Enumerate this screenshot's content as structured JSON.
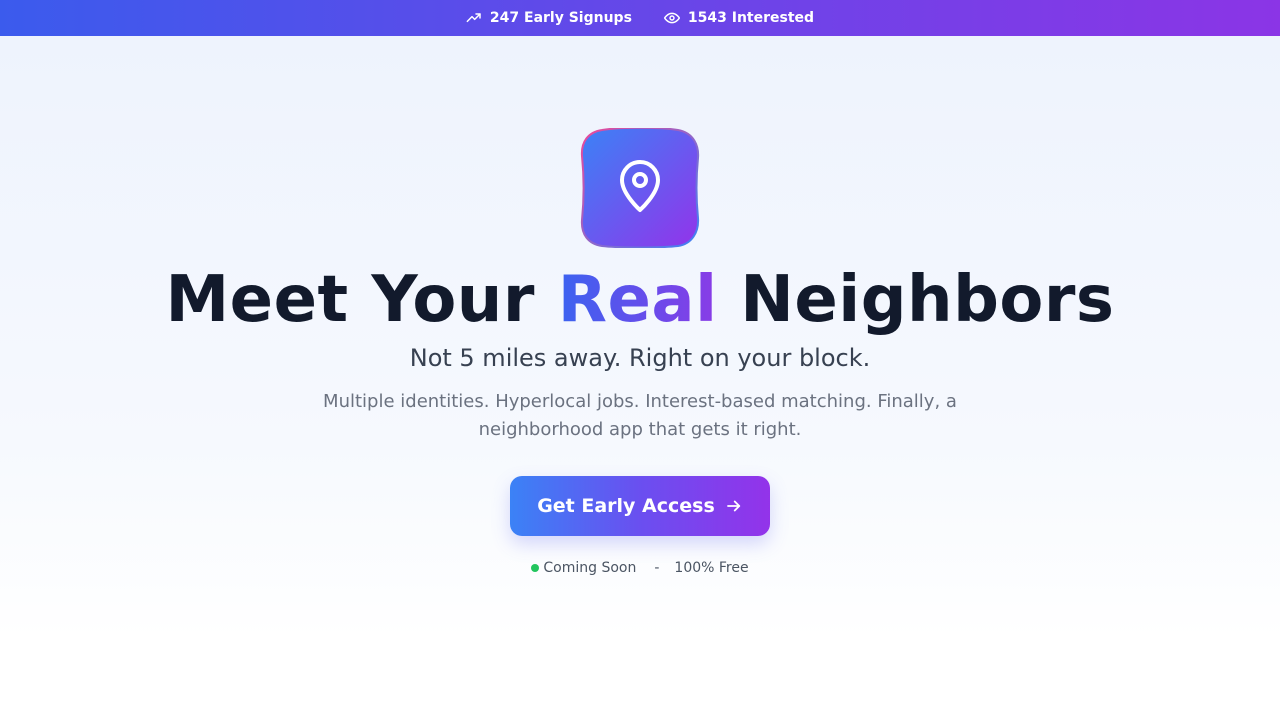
{
  "topbar": {
    "signups": "247 Early Signups",
    "interested": "1543 Interested",
    "signups_icon": "trending-up-icon",
    "interested_icon": "eye-icon"
  },
  "hero": {
    "logo_icon": "map-pin-icon",
    "headline_before": "Meet Your ",
    "headline_accent": "Real",
    "headline_after": " Neighbors",
    "subhead": "Not 5 miles away. Right on your block.",
    "description": "Multiple identities. Hyperlocal jobs. Interest-based matching. Finally, a neighborhood app that gets it right.",
    "cta_label": "Get Early Access",
    "cta_icon": "arrow-right-icon",
    "status_text": "Coming Soon",
    "separator": "-",
    "free_text": "100% Free"
  },
  "colors": {
    "brand_blue": "#3b82f6",
    "brand_purple": "#9333ea",
    "heading": "#121a2c",
    "status_green": "#22c55e"
  }
}
